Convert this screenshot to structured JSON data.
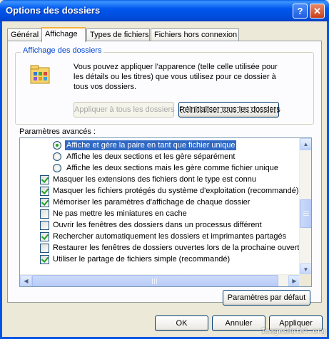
{
  "window": {
    "title": "Options des dossiers"
  },
  "title_buttons": {
    "help": "?",
    "close": "✕"
  },
  "tabs": [
    {
      "label": "Général"
    },
    {
      "label": "Affichage"
    },
    {
      "label": "Types de fichiers"
    },
    {
      "label": "Fichiers hors connexion"
    }
  ],
  "folder_view": {
    "heading": "Affichage des dossiers",
    "description": "Vous pouvez appliquer l'apparence (telle celle utilisée pour les détails ou les titres) que vous utilisez pour ce dossier à tous vos dossiers.",
    "apply_all_label": "Appliquer à tous les dossiers",
    "reset_all_label": "Réinitialiser tous les dossiers"
  },
  "advanced": {
    "label": "Paramètres avancés :",
    "items": [
      {
        "type": "radio",
        "checked": true,
        "selected": true,
        "label": "Affiche et gère la paire en tant que fichier unique"
      },
      {
        "type": "radio",
        "checked": false,
        "selected": false,
        "label": "Affiche les deux sections et les gère séparément"
      },
      {
        "type": "radio",
        "checked": false,
        "selected": false,
        "label": "Affiche les deux sections mais les gère comme fichier unique"
      },
      {
        "type": "check",
        "checked": true,
        "selected": false,
        "label": "Masquer les extensions des fichiers dont le type est connu"
      },
      {
        "type": "check",
        "checked": true,
        "selected": false,
        "label": "Masquer les fichiers protégés du système d'exploitation (recommandé)"
      },
      {
        "type": "check",
        "checked": true,
        "selected": false,
        "label": "Mémoriser les paramètres d'affichage de chaque dossier"
      },
      {
        "type": "check",
        "checked": false,
        "selected": false,
        "label": "Ne pas mettre les miniatures en cache"
      },
      {
        "type": "check",
        "checked": false,
        "selected": false,
        "label": "Ouvrir les fenêtres des dossiers dans un processus différent"
      },
      {
        "type": "check",
        "checked": true,
        "selected": false,
        "label": "Rechercher automatiquement les dossiers et imprimantes partagés"
      },
      {
        "type": "check",
        "checked": false,
        "selected": false,
        "label": "Restaurer les fenêtres de dossiers ouvertes lors de la prochaine ouverture"
      },
      {
        "type": "check",
        "checked": true,
        "selected": false,
        "label": "Utiliser le partage de fichiers simple (recommandé)"
      }
    ],
    "defaults_label": "Paramètres par défaut"
  },
  "scroll": {
    "up": "▲",
    "down": "▼",
    "left": "◀",
    "right": "▶"
  },
  "footer": {
    "ok": "OK",
    "cancel": "Annuler",
    "apply": "Appliquer"
  },
  "watermark": "ImagesHotel.org"
}
